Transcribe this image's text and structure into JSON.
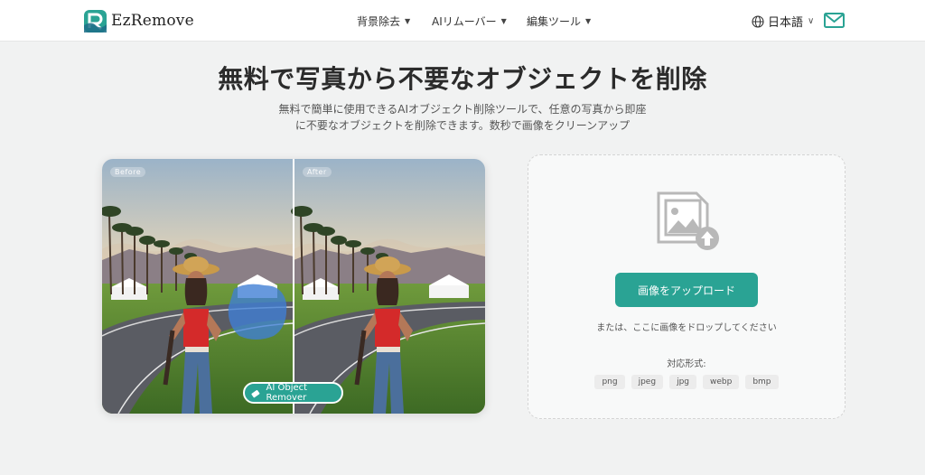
{
  "header": {
    "brand": "EzRemove",
    "nav": [
      {
        "label": "背景除去"
      },
      {
        "label": "AIリムーバー"
      },
      {
        "label": "編集ツール"
      }
    ],
    "language": "日本語"
  },
  "hero": {
    "title": "無料で写真から不要なオブジェクトを削除",
    "subtitle_line1": "無料で簡単に使用できるAIオブジェクト削除ツールで、任意の写真から即座",
    "subtitle_line2": "に不要なオブジェクトを削除できます。数秒で画像をクリーンアップ"
  },
  "comparison": {
    "before_label": "Before",
    "after_label": "After",
    "badge_label": "AI Object Remover"
  },
  "upload": {
    "button_label": "画像をアップロード",
    "drop_text": "または、ここに画像をドロップしてください",
    "formats_label": "対応形式:",
    "formats": [
      "png",
      "jpeg",
      "jpg",
      "webp",
      "bmp"
    ]
  },
  "colors": {
    "accent": "#2aa394",
    "background": "#f1f2f2"
  }
}
